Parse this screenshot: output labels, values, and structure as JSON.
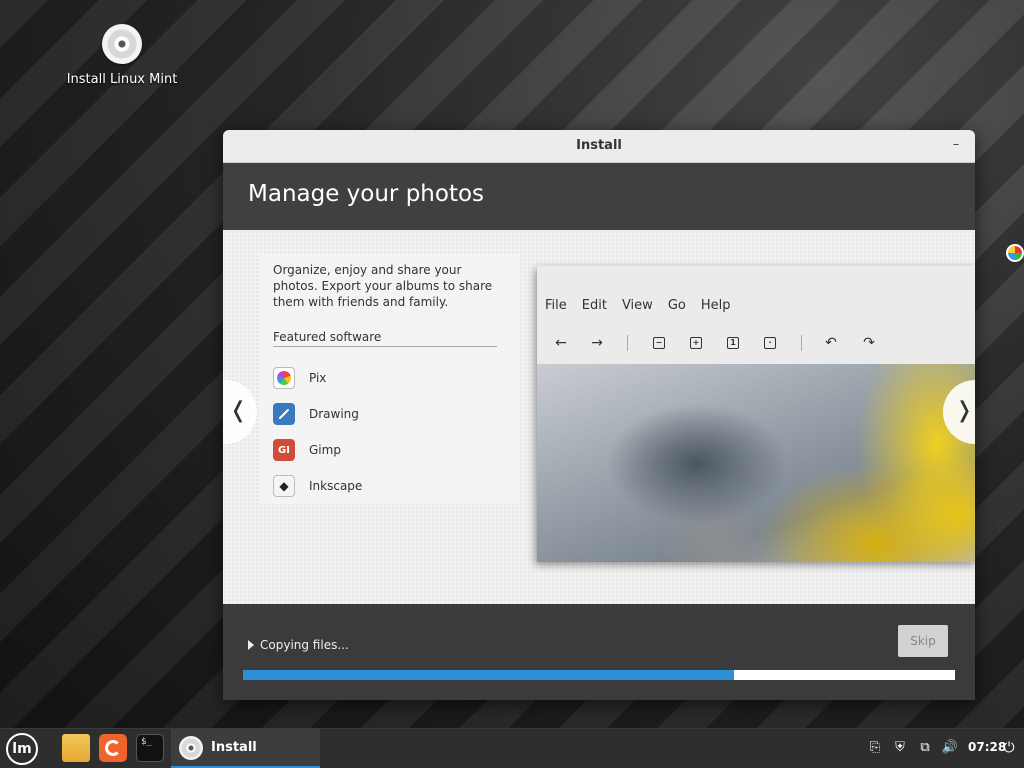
{
  "desktop": {
    "icon_label": "Install Linux Mint"
  },
  "window": {
    "title": "Install",
    "minimize_glyph": "–",
    "heading": "Manage your photos",
    "slide": {
      "description": "Organize, enjoy and share your photos. Export your albums to share them with friends and family.",
      "featured_label": "Featured software",
      "apps": [
        {
          "name": "Pix",
          "icon": "pix-icon"
        },
        {
          "name": "Drawing",
          "icon": "drawing-icon"
        },
        {
          "name": "Gimp",
          "icon": "gimp-icon",
          "glyph": "GI"
        },
        {
          "name": "Inkscape",
          "icon": "inkscape-icon",
          "glyph": "◆"
        }
      ],
      "viewer": {
        "menu": [
          "File",
          "Edit",
          "View",
          "Go",
          "Help"
        ],
        "toolbar": {
          "back": "←",
          "forward": "→",
          "zoom_out": "−",
          "zoom_in": "+",
          "actual_size": "1",
          "fit": "·",
          "rotate_left": "↶",
          "rotate_right": "↷"
        }
      },
      "prev_glyph": "❬",
      "next_glyph": "❭"
    },
    "footer": {
      "status": "Copying files...",
      "skip_label": "Skip",
      "progress_fraction": 0.69,
      "progress_color": "#2d8fd6"
    }
  },
  "taskbar": {
    "menu_glyph": "lm",
    "terminal_glyph": "$_",
    "task_label": "Install",
    "tray": {
      "clipboard": "⎘",
      "shield": "⛨",
      "network": "⧉",
      "volume": "🔊"
    },
    "clock": "07:28",
    "power_glyph": "⏻"
  }
}
